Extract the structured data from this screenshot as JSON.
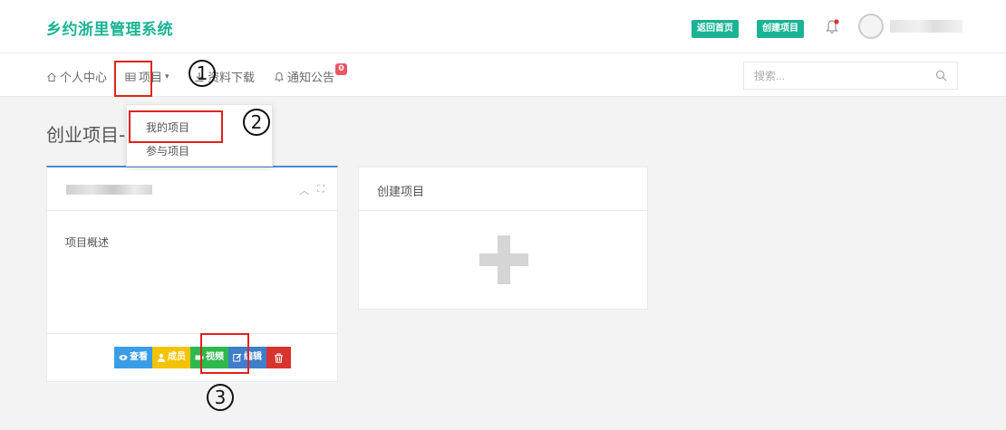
{
  "header": {
    "brand": "乡约浙里管理系统",
    "back_home_label": "返回首页",
    "create_project_label": "创建项目"
  },
  "nav": {
    "personal_center": "个人中心",
    "projects": "项目",
    "downloads": "资料下载",
    "notices": "通知公告",
    "notice_count": "0"
  },
  "search": {
    "placeholder": "搜索..."
  },
  "dropdown": {
    "items": [
      {
        "label": "我的项目"
      },
      {
        "label": "参与项目"
      }
    ]
  },
  "page": {
    "title": "创业项目-"
  },
  "project_card": {
    "summary": "项目概述",
    "actions": {
      "view": "查看",
      "members": "成员",
      "video": "视频",
      "edit": "编辑"
    }
  },
  "create_card": {
    "title": "创建项目"
  },
  "annotations": {
    "step1": "1",
    "step2": "2",
    "step3": "3"
  },
  "colors": {
    "brand": "#1ab394",
    "view": "#3a9de8",
    "members": "#f4c300",
    "video": "#2db94d",
    "edit": "#3e7ecb",
    "delete": "#d9332e",
    "highlight": "#e0231b"
  },
  "icons": {
    "home": "home-icon",
    "grid": "table-icon",
    "download": "download-icon",
    "bell": "bell-icon",
    "search": "search-icon",
    "eye": "eye-icon",
    "user": "user-icon",
    "video": "video-icon",
    "edit": "edit-icon",
    "trash": "trash-icon",
    "plus": "plus-icon"
  }
}
